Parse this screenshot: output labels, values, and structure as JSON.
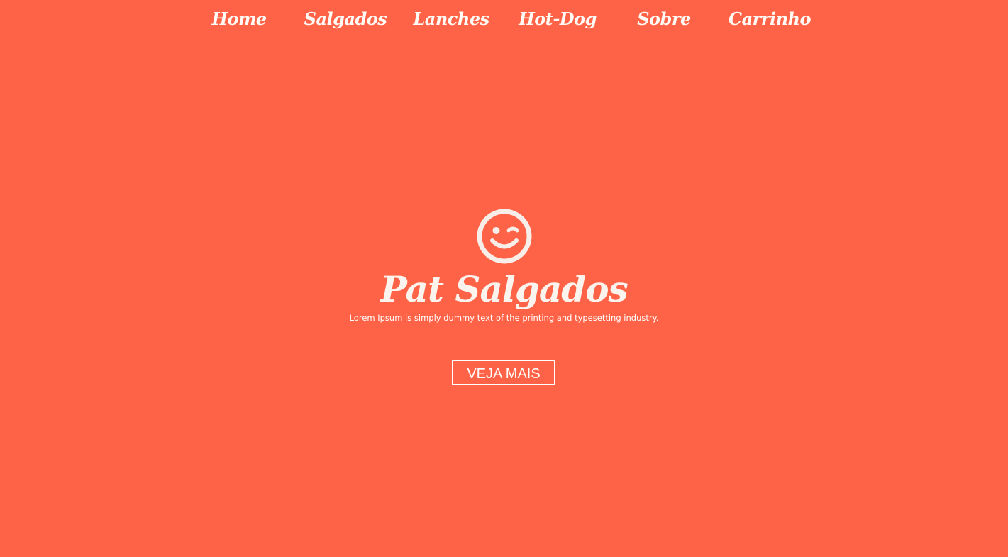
{
  "nav": {
    "items": [
      {
        "label": "Home"
      },
      {
        "label": "Salgados"
      },
      {
        "label": "Lanches"
      },
      {
        "label": "Hot-Dog"
      },
      {
        "label": "Sobre"
      },
      {
        "label": "Carrinho"
      }
    ]
  },
  "hero": {
    "icon": "wink-smiley-icon",
    "title": "Pat Salgados",
    "subtitle": "Lorem Ipsum is simply dummy text of the printing and typesetting industry.",
    "button_label": "VEJA MAIS"
  },
  "colors": {
    "background": "#ff6347",
    "text": "#ffffff"
  }
}
